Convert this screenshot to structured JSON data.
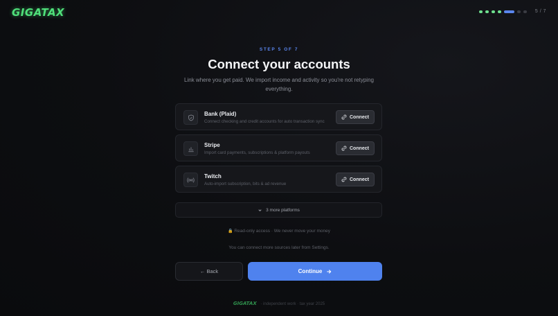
{
  "brand": {
    "logo": "GIGATAX",
    "accent": "#4fe07a"
  },
  "progress": {
    "completed": 4,
    "current": 5,
    "total": 7,
    "counter_text": "5 / 7"
  },
  "header": {
    "step_label": "STEP 5 OF 7",
    "title": "Connect your accounts",
    "subtitle": "Link where you get paid. We import income and activity so you're not retyping everything."
  },
  "accounts": [
    {
      "name": "Bank (Plaid)",
      "description": "Connect checking and credit accounts for auto transaction sync",
      "icon": "shield-icon",
      "button": "Connect"
    },
    {
      "name": "Stripe",
      "description": "Import card payments, subscriptions & platform payouts",
      "icon": "bar-chart-icon",
      "button": "Connect"
    },
    {
      "name": "Twitch",
      "description": "Auto-import subscription, bits & ad revenue",
      "icon": "broadcast-icon",
      "button": "Connect"
    }
  ],
  "more_platforms": {
    "label": "3 more platforms"
  },
  "notes": {
    "read_only": "Read-only access · We never move your money",
    "later": "You can connect more sources later from Settings."
  },
  "actions": {
    "back": "← Back",
    "continue": "Continue"
  },
  "footer": {
    "logo": "GIGATAX",
    "text": "· independent work · tax year 2025"
  },
  "colors": {
    "primary": "#4f82ee",
    "progress_done": "#6ee08e"
  }
}
